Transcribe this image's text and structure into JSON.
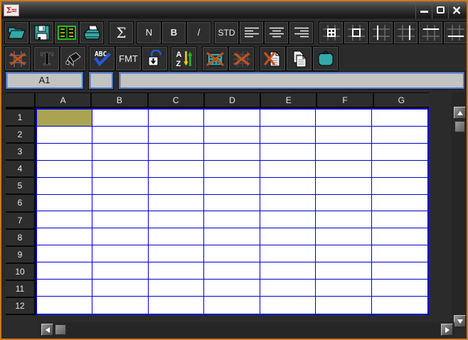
{
  "window": {
    "app_icon_glyph": "Σ=",
    "controls": [
      "minimize",
      "maximize",
      "close"
    ]
  },
  "toolbar_main": {
    "buttons": {
      "sigma": "Σ",
      "normal": "N",
      "bold": "B",
      "italic": "/",
      "standard": "STD"
    },
    "icons": [
      "open-folder-icon",
      "save-icon",
      "spreadsheet-icon",
      "printer-icon",
      "sum-icon",
      "align-left-icon",
      "align-center-icon",
      "align-right-icon",
      "border-all-icon",
      "border-outline-icon",
      "border-left-icon",
      "border-right-icon",
      "border-top-icon",
      "border-bottom-icon"
    ]
  },
  "toolbar_format": {
    "buttons": {
      "spellcheck": "ABC",
      "format": "FMT",
      "sort_a": "A",
      "sort_z": "Z"
    },
    "icons": [
      "clear-borders-icon",
      "text-color-icon",
      "fill-bucket-icon",
      "spellcheck-icon",
      "lock-icon",
      "sort-az-icon",
      "delete-table-icon",
      "clear-grid-icon",
      "delete-document-icon",
      "copy-icon",
      "paste-icon"
    ]
  },
  "formula_bar": {
    "cell_reference": "A1",
    "selection_box": "",
    "formula_input": ""
  },
  "spreadsheet": {
    "columns": [
      "A",
      "B",
      "C",
      "D",
      "E",
      "F",
      "G"
    ],
    "rows": [
      "1",
      "2",
      "3",
      "4",
      "5",
      "6",
      "7",
      "8",
      "9",
      "10",
      "11",
      "12"
    ],
    "selected_cell": "A1",
    "cell_values": {}
  },
  "colors": {
    "window_border": "#c9791e",
    "selection": "#a9a352",
    "gridline": "#0000cc",
    "header_bg": "#2d2d2d",
    "formula_box_bg": "#c3c3c3",
    "formula_box_border": "#4a77c9",
    "toolbar_icon_teal": "#35a8a8",
    "toolbar_icon_red": "#c2511f",
    "toolbar_icon_blue": "#2757d6",
    "toolbar_icon_green": "#1fbf1f",
    "toolbar_icon_yellow": "#e8d020"
  }
}
